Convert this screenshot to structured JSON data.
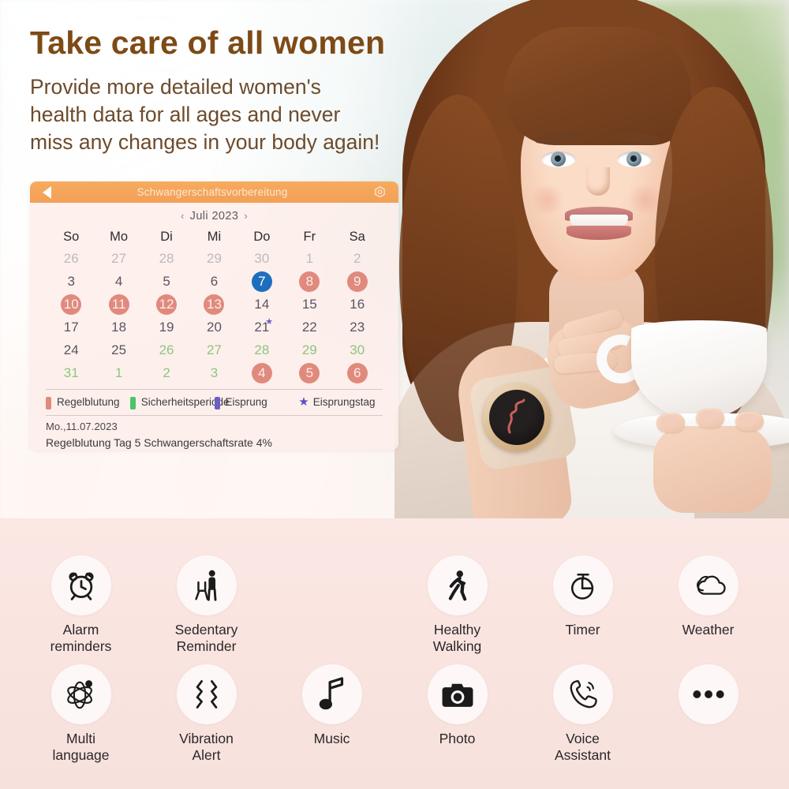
{
  "headline": {
    "title": "Take care of all women",
    "subtitle": "Provide more detailed women's\nhealth data for all ages and never\nmiss any changes in your body again!",
    "title_color": "#7d4a16",
    "subtitle_color": "#6d4b2b"
  },
  "calendar": {
    "back_icon": "back-triangle-icon",
    "title": "Schwangerschaftsvorbereitung",
    "settings_icon": "gear-icon",
    "prev_arrow": "‹",
    "next_arrow": "›",
    "month_label": "Juli 2023",
    "bar_color": "#f2a057",
    "weekdays": [
      "So",
      "Mo",
      "Di",
      "Mi",
      "Do",
      "Fr",
      "Sa"
    ],
    "weeks": [
      [
        {
          "d": "26",
          "style": "c-out"
        },
        {
          "d": "27",
          "style": "c-out"
        },
        {
          "d": "28",
          "style": "c-out"
        },
        {
          "d": "29",
          "style": "c-out"
        },
        {
          "d": "30",
          "style": "c-out"
        },
        {
          "d": "1",
          "style": "c-out"
        },
        {
          "d": "2",
          "style": "c-out"
        }
      ],
      [
        {
          "d": "3",
          "style": "c-norm"
        },
        {
          "d": "4",
          "style": "c-norm"
        },
        {
          "d": "5",
          "style": "c-norm"
        },
        {
          "d": "6",
          "style": "c-norm"
        },
        {
          "d": "7",
          "style": "c-dot-blue"
        },
        {
          "d": "8",
          "style": "c-dot-red"
        },
        {
          "d": "9",
          "style": "c-dot-red"
        }
      ],
      [
        {
          "d": "10",
          "style": "c-dot-red"
        },
        {
          "d": "11",
          "style": "c-dot-red"
        },
        {
          "d": "12",
          "style": "c-dot-red"
        },
        {
          "d": "13",
          "style": "c-dot-red"
        },
        {
          "d": "14",
          "style": "c-norm"
        },
        {
          "d": "15",
          "style": "c-norm"
        },
        {
          "d": "16",
          "style": "c-norm"
        }
      ],
      [
        {
          "d": "17",
          "style": "c-norm"
        },
        {
          "d": "18",
          "style": "c-norm"
        },
        {
          "d": "19",
          "style": "c-norm"
        },
        {
          "d": "20",
          "style": "c-norm"
        },
        {
          "d": "21",
          "style": "c-norm",
          "star": true
        },
        {
          "d": "22",
          "style": "c-norm"
        },
        {
          "d": "23",
          "style": "c-norm"
        }
      ],
      [
        {
          "d": "24",
          "style": "c-norm"
        },
        {
          "d": "25",
          "style": "c-norm"
        },
        {
          "d": "26",
          "style": "c-green"
        },
        {
          "d": "27",
          "style": "c-green"
        },
        {
          "d": "28",
          "style": "c-green"
        },
        {
          "d": "29",
          "style": "c-green"
        },
        {
          "d": "30",
          "style": "c-green"
        }
      ],
      [
        {
          "d": "31",
          "style": "c-green"
        },
        {
          "d": "1",
          "style": "c-green"
        },
        {
          "d": "2",
          "style": "c-green"
        },
        {
          "d": "3",
          "style": "c-green"
        },
        {
          "d": "4",
          "style": "c-dot-red"
        },
        {
          "d": "5",
          "style": "c-dot-red"
        },
        {
          "d": "6",
          "style": "c-dot-red"
        }
      ]
    ],
    "legend": [
      {
        "label": "Regelblutung",
        "color": "#e08a7d",
        "type": "swatch"
      },
      {
        "label": "Sicherheitsperiode",
        "color": "#4fc36a",
        "type": "swatch"
      },
      {
        "label": "Eisprung",
        "color": "#6b5fc6",
        "type": "swatch"
      },
      {
        "label": "Eisprungstag",
        "color": "#5a4fbe",
        "type": "star"
      }
    ],
    "footer_date": "Mo.,11.07.2023",
    "footer_status": "Regelblutung Tag 5 Schwangerschaftsrate 4%"
  },
  "features": {
    "row1": [
      {
        "label": "Alarm\nreminders",
        "icon": "alarm-clock-icon"
      },
      {
        "label": "Sedentary\nReminder",
        "icon": "sedentary-person-chair-icon"
      },
      {
        "label": "",
        "icon": "none"
      },
      {
        "label": "Healthy\nWalking",
        "icon": "walking-person-icon"
      },
      {
        "label": "Timer",
        "icon": "stopwatch-icon"
      },
      {
        "label": "Weather",
        "icon": "cloud-icon"
      }
    ],
    "row2": [
      {
        "label": "Multi\nlanguage",
        "icon": "atom-multi-language-icon"
      },
      {
        "label": "Vibration\nAlert",
        "icon": "vibration-waves-icon"
      },
      {
        "label": "Music",
        "icon": "music-note-icon"
      },
      {
        "label": "Photo",
        "icon": "camera-icon"
      },
      {
        "label": "Voice\nAssistant",
        "icon": "phone-voice-icon"
      },
      {
        "label": "",
        "icon": "more-dots-icon"
      }
    ],
    "background_color": "#f9e4e0",
    "bubble_color": "#fdf8f7"
  },
  "photo": {
    "description": "smiling-woman-holding-coffee-cup-wearing-smartwatch",
    "watch_face": "heart-rate-waveform"
  }
}
